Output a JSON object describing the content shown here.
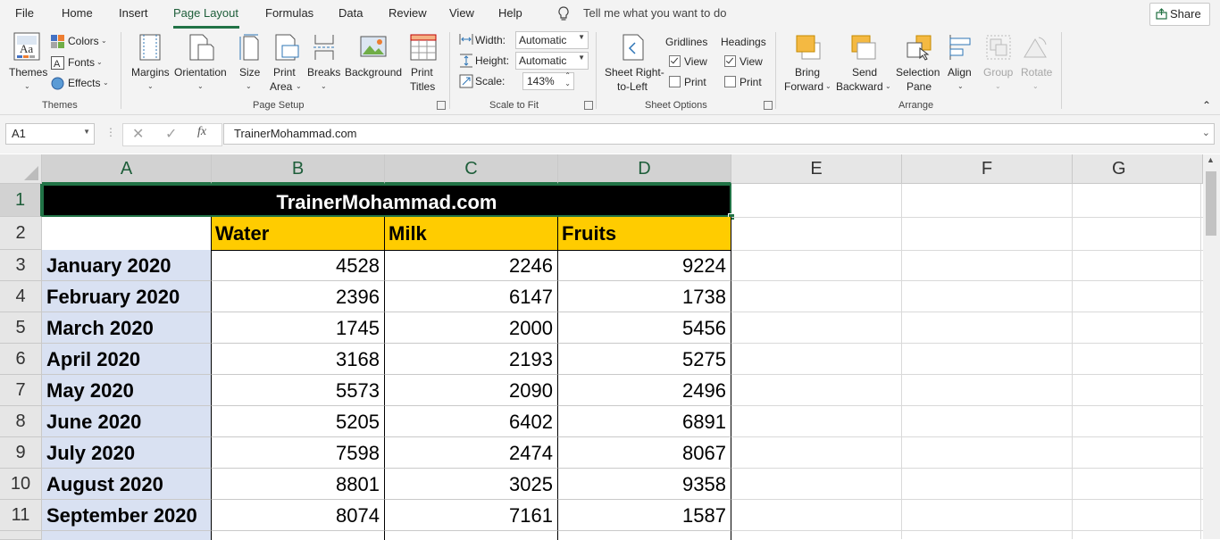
{
  "menu": {
    "tabs": [
      "File",
      "Home",
      "Insert",
      "Page Layout",
      "Formulas",
      "Data",
      "Review",
      "View",
      "Help"
    ],
    "tell_me": "Tell me what you want to do",
    "share": "Share"
  },
  "ribbon": {
    "themes": {
      "themes": "Themes",
      "colors": "Colors",
      "fonts": "Fonts",
      "effects": "Effects",
      "group": "Themes"
    },
    "page_setup": {
      "margins": "Margins",
      "orientation": "Orientation",
      "size": "Size",
      "print_area_1": "Print",
      "print_area_2": "Area",
      "breaks": "Breaks",
      "background": "Background",
      "print_titles_1": "Print",
      "print_titles_2": "Titles",
      "group": "Page Setup"
    },
    "scale": {
      "width_label": "Width:",
      "width_value": "Automatic",
      "height_label": "Height:",
      "height_value": "Automatic",
      "scale_label": "Scale:",
      "scale_value": "143%",
      "group": "Scale to Fit"
    },
    "sheet_options": {
      "sheet_rtl_1": "Sheet Right-",
      "sheet_rtl_2": "to-Left",
      "gridlines": "Gridlines",
      "headings": "Headings",
      "view": "View",
      "print": "Print",
      "group": "Sheet Options"
    },
    "arrange": {
      "bring_1": "Bring",
      "bring_2": "Forward",
      "send_1": "Send",
      "send_2": "Backward",
      "selection_1": "Selection",
      "selection_2": "Pane",
      "align": "Align",
      "group_btn": "Group",
      "rotate": "Rotate",
      "group": "Arrange"
    }
  },
  "formula_bar": {
    "name_box": "A1",
    "fx": "fx",
    "content": "TrainerMohammad.com"
  },
  "sheet": {
    "columns": [
      "A",
      "B",
      "C",
      "D",
      "E",
      "F",
      "G"
    ],
    "title": "TrainerMohammad.com",
    "headers": [
      "Water",
      "Milk",
      "Fruits"
    ],
    "rows": [
      {
        "n": "3",
        "month": "January 2020",
        "water": "4528",
        "milk": "2246",
        "fruits": "9224"
      },
      {
        "n": "4",
        "month": "February 2020",
        "water": "2396",
        "milk": "6147",
        "fruits": "1738"
      },
      {
        "n": "5",
        "month": "March 2020",
        "water": "1745",
        "milk": "2000",
        "fruits": "5456"
      },
      {
        "n": "6",
        "month": "April 2020",
        "water": "3168",
        "milk": "2193",
        "fruits": "5275"
      },
      {
        "n": "7",
        "month": "May 2020",
        "water": "5573",
        "milk": "2090",
        "fruits": "2496"
      },
      {
        "n": "8",
        "month": "June 2020",
        "water": "5205",
        "milk": "6402",
        "fruits": "6891"
      },
      {
        "n": "9",
        "month": "July 2020",
        "water": "7598",
        "milk": "2474",
        "fruits": "8067"
      },
      {
        "n": "10",
        "month": "August 2020",
        "water": "8801",
        "milk": "3025",
        "fruits": "9358"
      },
      {
        "n": "11",
        "month": "September 2020",
        "water": "8074",
        "milk": "7161",
        "fruits": "1587"
      }
    ]
  },
  "colors": {
    "accent": "#217346",
    "header_fill": "#ffcc00",
    "month_fill": "#d9e1f2",
    "title_fill": "#000000"
  }
}
